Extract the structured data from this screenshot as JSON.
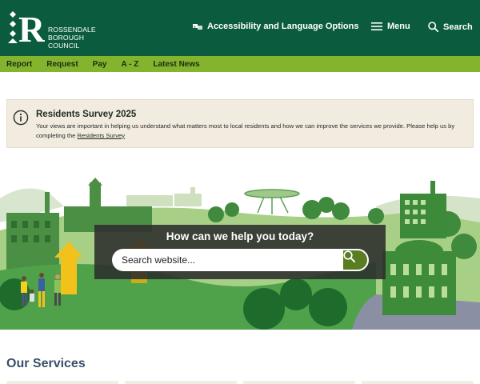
{
  "header": {
    "logo": {
      "letter": "R",
      "lines": [
        "ROSSENDALE",
        "BOROUGH",
        "COUNCIL"
      ]
    },
    "accessibility_label": "Accessibility and Language Options",
    "menu_label": "Menu",
    "search_label": "Search"
  },
  "nav": {
    "items": [
      "Report",
      "Request",
      "Pay",
      "A - Z",
      "Latest News"
    ]
  },
  "survey": {
    "title": "Residents Survey 2025",
    "text": "Your views are important in helping us understand what matters most to local residents and how we can improve the services we provide. Please help us by completing the",
    "link": "Residents Survey"
  },
  "hero": {
    "question": "How can we help you today?",
    "search_placeholder": "Search website..."
  },
  "services": {
    "title": "Our Services"
  },
  "colors": {
    "header_green": "#0b5c3e",
    "nav_green": "#84b42d",
    "banner_beige": "#f2ebdf",
    "search_button_green": "#5a7d22",
    "services_heading": "#3a4f6a"
  }
}
